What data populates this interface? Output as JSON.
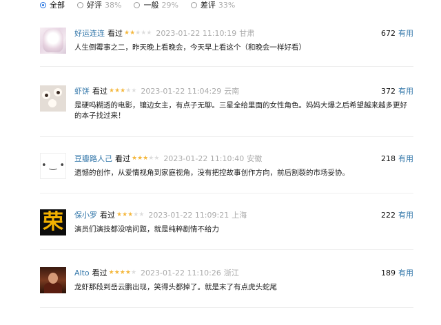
{
  "filters": [
    {
      "label": "全部",
      "pct": "",
      "checked": true
    },
    {
      "label": "好评",
      "pct": "38%",
      "checked": false
    },
    {
      "label": "一般",
      "pct": "29%",
      "checked": false
    },
    {
      "label": "差评",
      "pct": "33%",
      "checked": false
    }
  ],
  "useful_label": "有用",
  "watched_label": "看过",
  "reviews": [
    {
      "user": "好运连连",
      "rating": 2,
      "time": "2023-01-22 11:10:19",
      "location": "甘肃",
      "votes": "672",
      "content": "人生倒霉事之二，昨天晚上看晚会，今天早上看这个（和晚会一样好看）",
      "avatar_icon": "anime-girl-avatar"
    },
    {
      "user": "虾饼",
      "rating": 3,
      "time": "2023-01-22 11:04:29",
      "location": "云南",
      "votes": "372",
      "content": "是硬吗糊透的电影，镶边女主，有点子无聊。三星全给里面的女性角色。妈妈大爆之后希望越来越多更好的本子找过来！",
      "avatar_icon": "plush-toy-avatar"
    },
    {
      "user": "豆瓣路人己",
      "rating": 3,
      "time": "2023-01-22 11:10:40",
      "location": "安徽",
      "votes": "218",
      "content": "遗憾的创作，从爱情视角到家庭视角，没有把控故事创作方向，前后割裂的市场妥协。",
      "avatar_icon": "smiley-avatar"
    },
    {
      "user": "保小罗",
      "rating": 3,
      "time": "2023-01-22 11:09:21",
      "location": "上海",
      "votes": "222",
      "content": "演员们演技都没啥问题，就是纯粹剧情不给力",
      "avatar_icon": "yellow-glyph-avatar"
    },
    {
      "user": "Alto",
      "rating": 4,
      "time": "2023-01-22 11:10:26",
      "location": "浙江",
      "votes": "189",
      "content": "龙虾那段到岳云鹏出现，笑得头都掉了。就是末了有点虎头蛇尾",
      "avatar_icon": "photo-avatar"
    }
  ],
  "avatar_glyphs": {
    "smiley": "• ‿ •",
    "yellow": "荣"
  }
}
